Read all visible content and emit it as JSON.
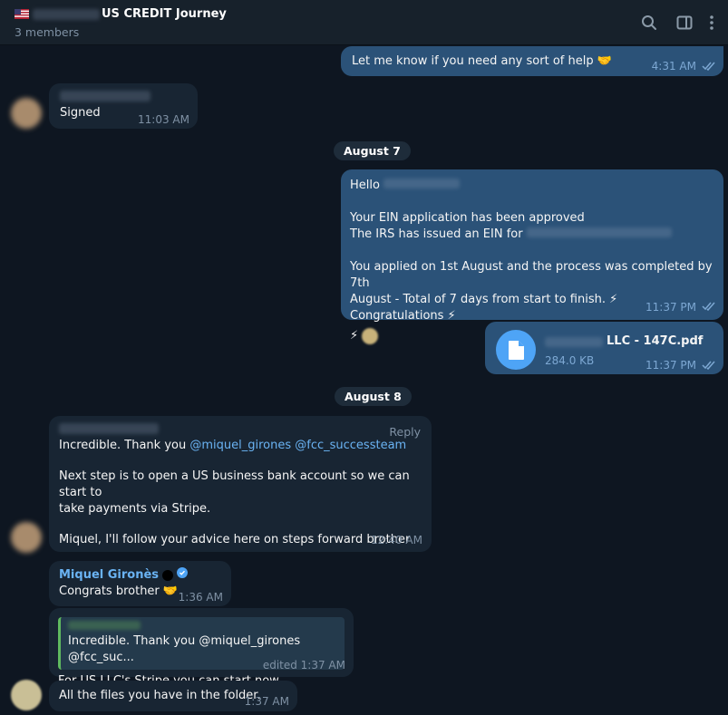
{
  "header": {
    "title": "US CREDIT Journey",
    "members": "3 members"
  },
  "icons": {
    "search": "search-icon",
    "sidebar": "sidebar-toggle-icon",
    "menu": "more-vertical-icon"
  },
  "messages": {
    "m1": {
      "text": "Let me know if you need any sort of help 🤝",
      "time": "4:31 AM"
    },
    "m2": {
      "text": "Signed",
      "time": "11:03 AM"
    },
    "date1": "August 7",
    "m3": {
      "greeting": "Hello",
      "line1": "Your EIN application has been approved",
      "line2": "The IRS has issued an EIN for",
      "line3": "You applied on 1st August and the process was completed by 7th",
      "line4": "August - Total of 7 days from start to finish. ⚡ Congratulations ⚡",
      "reaction": "⚡",
      "time": "11:37 PM"
    },
    "m4": {
      "filename": "LLC - 147C.pdf",
      "size": "284.0 KB",
      "time": "11:37 PM"
    },
    "date2": "August 8",
    "m5": {
      "reply": "Reply",
      "line1_prefix": "Incredible. Thank you ",
      "mention1": "@miquel_girones",
      "mention2": "@fcc_successteam",
      "line2": "Next step is to open a US business bank account so we can start to",
      "line3": "take payments via Stripe.",
      "line4": "Miquel, I'll follow your advice here on steps forward brother",
      "time": "12:40 AM"
    },
    "m6": {
      "sender": "Miquel Gironès",
      "text": "Congrats brother 🤝",
      "time": "1:36 AM"
    },
    "m7": {
      "quote": "Incredible. Thank you @miquel_girones @fcc_suc...",
      "text": "For US LLC's Stripe you can start now.",
      "time": "edited 1:37 AM"
    },
    "m8": {
      "text": "All the files you have in the folder.",
      "time": "1:37 AM"
    }
  },
  "colors": {
    "background": "#0e1621",
    "outgoing": "#2b5278",
    "incoming": "#182533",
    "accent": "#6ab3f3"
  }
}
